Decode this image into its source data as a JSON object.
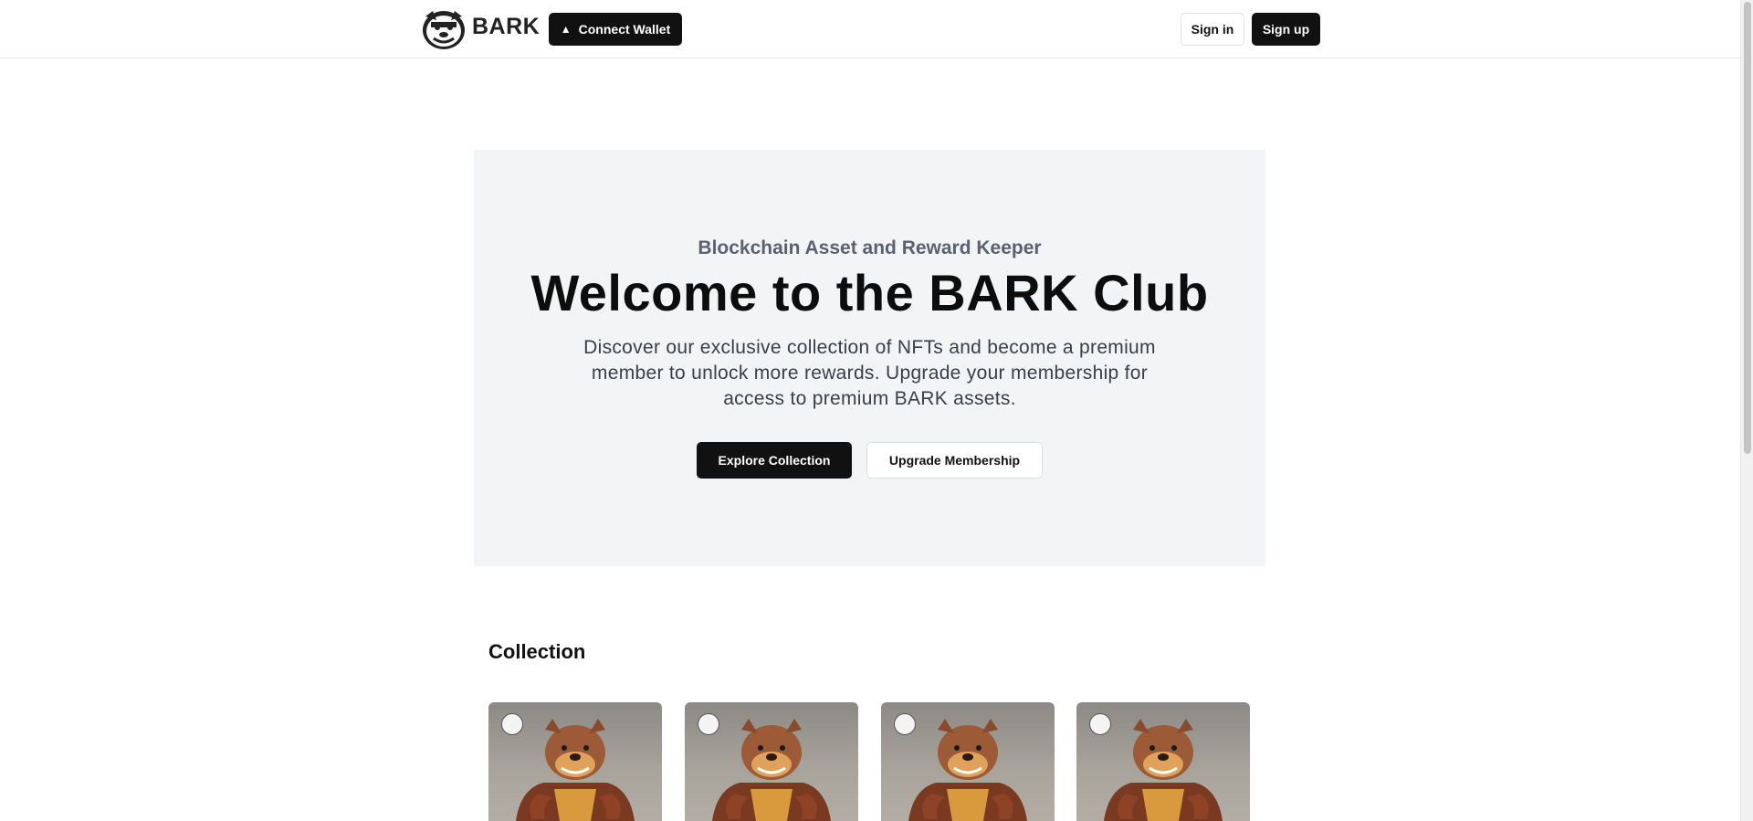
{
  "header": {
    "brand": "BARK",
    "connect_wallet": "Connect Wallet",
    "sign_in": "Sign in",
    "sign_up": "Sign up"
  },
  "hero": {
    "subtitle": "Blockchain Asset and Reward Keeper",
    "title": "Welcome to the BARK Club",
    "description": "Discover our exclusive collection of NFTs and become a premium member to unlock more rewards. Upgrade your membership for access to premium BARK assets.",
    "explore_button": "Explore Collection",
    "upgrade_button": "Upgrade Membership"
  },
  "collection": {
    "title": "Collection",
    "items": [
      {
        "image": "bulldog-nft-image",
        "badge_icon": "bark-logo-icon"
      },
      {
        "image": "bulldog-nft-image",
        "badge_icon": "bark-logo-icon"
      },
      {
        "image": "bulldog-nft-image",
        "badge_icon": "bark-logo-icon"
      },
      {
        "image": "bulldog-nft-image",
        "badge_icon": "bark-logo-icon"
      }
    ]
  },
  "colors": {
    "primary_button": "#111111",
    "hero_background": "#f3f4f5",
    "subtitle": "#596270"
  }
}
